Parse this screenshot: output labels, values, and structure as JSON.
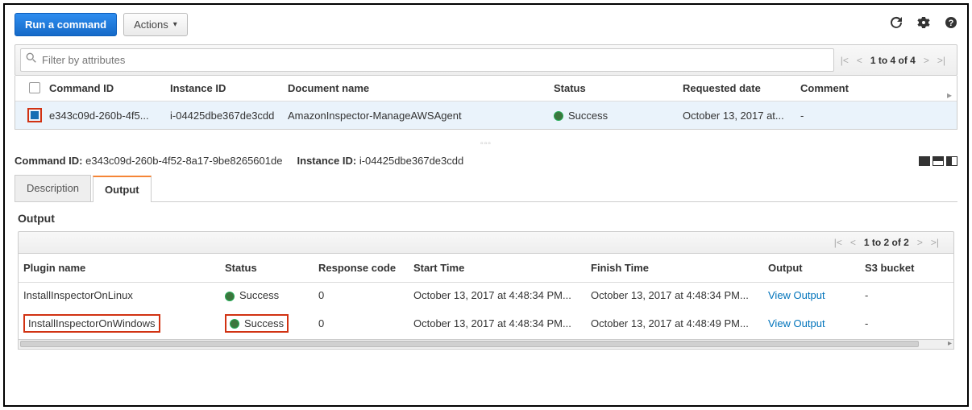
{
  "toolbar": {
    "run_command_label": "Run a command",
    "actions_label": "Actions"
  },
  "filter": {
    "placeholder": "Filter by attributes"
  },
  "pager_top": {
    "text": "1 to 4 of 4"
  },
  "main_table": {
    "headers": {
      "command_id": "Command ID",
      "instance_id": "Instance ID",
      "document_name": "Document name",
      "status": "Status",
      "requested_date": "Requested date",
      "comment": "Comment"
    },
    "rows": [
      {
        "command_id": "e343c09d-260b-4f5...",
        "instance_id": "i-04425dbe367de3cdd",
        "document_name": "AmazonInspector-ManageAWSAgent",
        "status": "Success",
        "requested_date": "October 13, 2017 at...",
        "comment": "-"
      }
    ]
  },
  "detail": {
    "command_id_label": "Command ID:",
    "command_id_value": "e343c09d-260b-4f52-8a17-9be8265601de",
    "instance_id_label": "Instance ID:",
    "instance_id_value": "i-04425dbe367de3cdd"
  },
  "tabs": {
    "description": "Description",
    "output": "Output"
  },
  "output": {
    "title": "Output",
    "pager_text": "1 to 2 of 2",
    "headers": {
      "plugin_name": "Plugin name",
      "status": "Status",
      "response_code": "Response code",
      "start_time": "Start Time",
      "finish_time": "Finish Time",
      "output": "Output",
      "s3_bucket": "S3 bucket"
    },
    "rows": [
      {
        "plugin_name": "InstallInspectorOnLinux",
        "status": "Success",
        "response_code": "0",
        "start_time": "October 13, 2017 at 4:48:34 PM...",
        "finish_time": "October 13, 2017 at 4:48:34 PM...",
        "output_link": "View Output",
        "s3_bucket": "-",
        "highlighted": false
      },
      {
        "plugin_name": "InstallInspectorOnWindows",
        "status": "Success",
        "response_code": "0",
        "start_time": "October 13, 2017 at 4:48:34 PM...",
        "finish_time": "October 13, 2017 at 4:48:49 PM...",
        "output_link": "View Output",
        "s3_bucket": "-",
        "highlighted": true
      }
    ]
  }
}
